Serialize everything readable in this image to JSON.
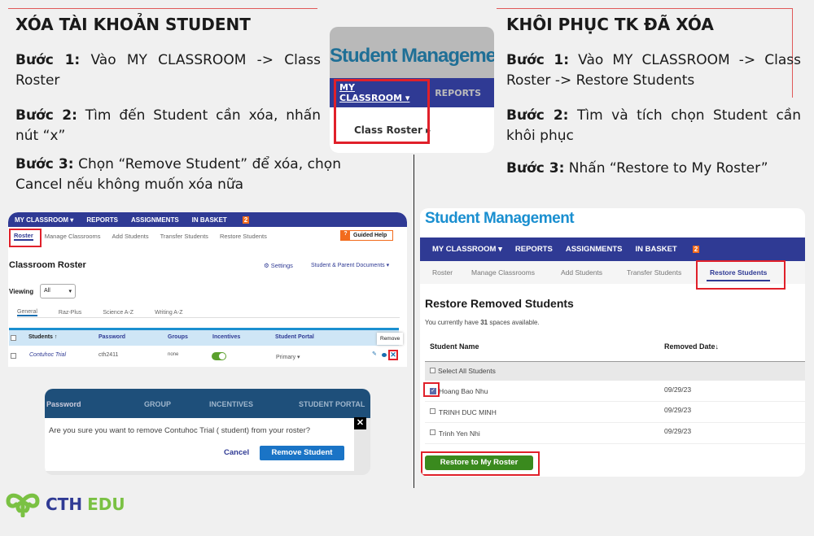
{
  "left": {
    "title": "XÓA TÀI KHOẢN STUDENT",
    "steps": [
      {
        "label": "Bước 1:",
        "text": "Vào MY CLASSROOM -> Class Roster"
      },
      {
        "label": "Bước 2:",
        "text": "Tìm đến Student cần xóa, nhấn nút “x”"
      },
      {
        "label": "Bước 3:",
        "text": "Chọn “Remove Student” để xóa, chọn Cancel nếu không muốn xóa nữa"
      }
    ]
  },
  "right": {
    "title": "KHÔI PHỤC TK ĐÃ XÓA",
    "steps": [
      {
        "label": "Bước 1:",
        "text": "Vào MY CLASSROOM -> Class Roster -> Restore Students"
      },
      {
        "label": "Bước 2:",
        "text": "Tìm và tích chọn Student cần khôi phục"
      },
      {
        "label": "Bước 3:",
        "text": "Nhấn “Restore to My Roster”"
      }
    ]
  },
  "center_shot": {
    "brand": "Student Management",
    "nav_my_classroom": "MY CLASSROOM ▾",
    "nav_reports": "REPORTS",
    "menu_item": "Class Roster ▸"
  },
  "roster_shot": {
    "nav": [
      "MY CLASSROOM ▾",
      "REPORTS",
      "ASSIGNMENTS",
      "IN BASKET"
    ],
    "basket_count": "2",
    "subnav": [
      "Roster",
      "Manage Classrooms",
      "Add Students",
      "Transfer Students",
      "Restore Students"
    ],
    "guided_help": "Guided Help",
    "title": "Classroom Roster",
    "settings": "⚙ Settings",
    "documents": "Student & Parent Documents ▾",
    "viewing_label": "Viewing",
    "viewing_value": "All",
    "tabs": [
      "General",
      "Raz-Plus",
      "Science A-Z",
      "Writing A-Z"
    ],
    "columns": [
      "Students ↑",
      "Password",
      "Groups",
      "Incentives",
      "Student Portal"
    ],
    "row": {
      "student": "Contuhoc Trial",
      "password": "cth2411",
      "groups": "none",
      "incentives_on": true,
      "portal": "Primary ▾"
    },
    "tooltip": "Remove"
  },
  "dialog": {
    "header": [
      "Password",
      "GROUP",
      "INCENTIVES",
      "STUDENT PORTAL"
    ],
    "message": "Are you sure you want to remove Contuhoc Trial ( student) from your roster?",
    "cancel": "Cancel",
    "remove": "Remove Student"
  },
  "restore_shot": {
    "brand": "Student Management",
    "nav": [
      "MY CLASSROOM ▾",
      "REPORTS",
      "ASSIGNMENTS",
      "IN BASKET"
    ],
    "basket_count": "2",
    "subnav": [
      "Roster",
      "Manage Classrooms",
      "Add Students",
      "Transfer Students",
      "Restore Students"
    ],
    "title": "Restore Removed Students",
    "spaces_pre": "You currently have ",
    "spaces_count": "31",
    "spaces_post": " spaces available.",
    "col_name": "Student Name",
    "col_date": "Removed Date↓",
    "select_all": "Select All Students",
    "rows": [
      {
        "name": "Hoang Bao Nhu",
        "date": "09/29/23",
        "checked": true
      },
      {
        "name": "TRINH DUC MINH",
        "date": "09/29/23",
        "checked": false
      },
      {
        "name": "Trinh Yen Nhi",
        "date": "09/29/23",
        "checked": false
      }
    ],
    "button": "Restore to My Roster"
  },
  "logo": {
    "text_cth": "CTH",
    "text_edu": "EDU"
  },
  "colors": {
    "nav": "#2f3a94",
    "brand": "#1a8fd0",
    "highlight": "#e0202a",
    "green": "#3a8a1e",
    "logo_green": "#7ac143",
    "logo_blue": "#2f3a94"
  }
}
